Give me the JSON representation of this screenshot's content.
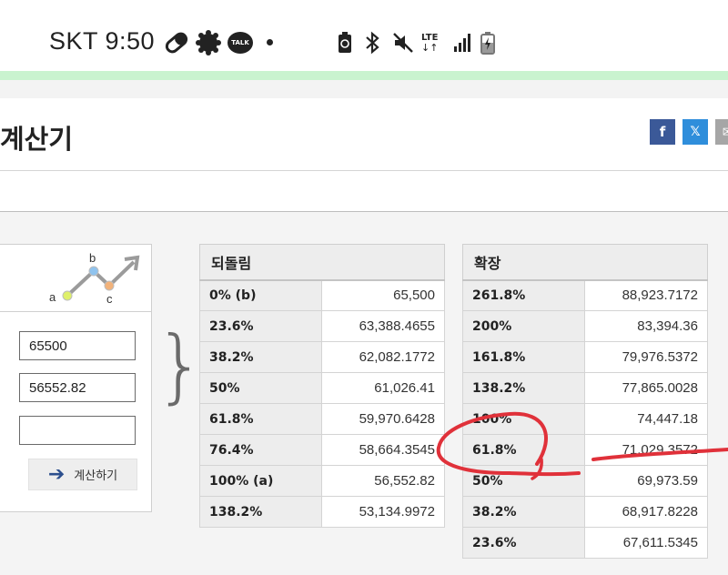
{
  "status_bar": {
    "carrier_time": "SKT 9:50",
    "app_icons": [
      "pill-icon",
      "settings-gear-icon",
      "kakaotalk-icon"
    ],
    "talk_label": "TALK",
    "system_icons": [
      "recycle-battery-icon",
      "bluetooth-icon",
      "mute-icon",
      "lte-icon",
      "signal-icon",
      "battery-charging-icon"
    ],
    "lte_label": "LTE"
  },
  "page": {
    "title": "계산기",
    "share": {
      "facebook": "f",
      "twitter": "𝕏",
      "email": "✉"
    }
  },
  "input_panel": {
    "diagram_labels": {
      "a": "a",
      "b": "b",
      "c": "c"
    },
    "fields": [
      {
        "value": "65500"
      },
      {
        "value": "56552.82"
      },
      {
        "value": ""
      }
    ],
    "calc_button": "계산하기"
  },
  "retracement": {
    "header": "되돌림",
    "rows": [
      {
        "label": "0% (b)",
        "value": "65,500"
      },
      {
        "label": "23.6%",
        "value": "63,388.4655"
      },
      {
        "label": "38.2%",
        "value": "62,082.1772"
      },
      {
        "label": "50%",
        "value": "61,026.41"
      },
      {
        "label": "61.8%",
        "value": "59,970.6428"
      },
      {
        "label": "76.4%",
        "value": "58,664.3545"
      },
      {
        "label": "100% (a)",
        "value": "56,552.82"
      },
      {
        "label": "138.2%",
        "value": "53,134.9972"
      }
    ]
  },
  "extension": {
    "header": "확장",
    "rows": [
      {
        "label": "261.8%",
        "value": "88,923.7172"
      },
      {
        "label": "200%",
        "value": "83,394.36"
      },
      {
        "label": "161.8%",
        "value": "79,976.5372"
      },
      {
        "label": "138.2%",
        "value": "77,865.0028"
      },
      {
        "label": "100%",
        "value": "74,447.18"
      },
      {
        "label": "61.8%",
        "value": "71,029.3572"
      },
      {
        "label": "50%",
        "value": "69,973.59"
      },
      {
        "label": "38.2%",
        "value": "68,917.8228"
      },
      {
        "label": "23.6%",
        "value": "67,611.5345"
      }
    ]
  },
  "colors": {
    "annotation": "#e0313a",
    "header_bg": "#ededed",
    "facebook": "#3b5998",
    "twitter": "#2f8edb"
  }
}
